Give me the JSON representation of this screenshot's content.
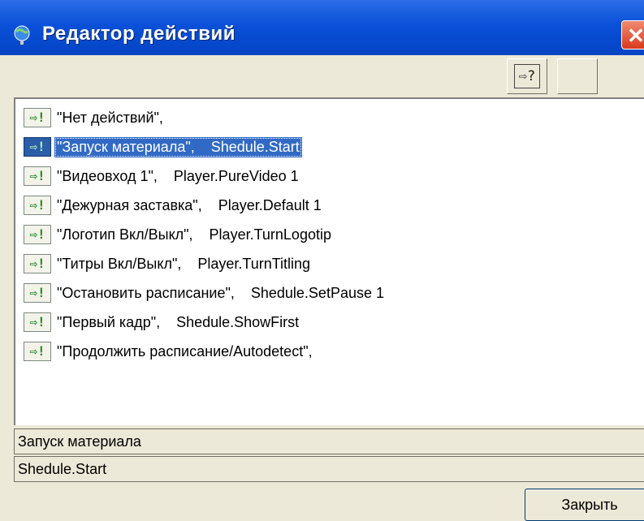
{
  "window": {
    "title": "Редактор действий",
    "close_glyph": "✕"
  },
  "toolbar": {
    "help_button_glyph": "⇨?",
    "second_button_label": ""
  },
  "actions": {
    "icon_glyph": "⇨!",
    "selected_index": 1,
    "items": [
      {
        "text": "\"Нет действий\","
      },
      {
        "text": "\"Запуск материала\",    Shedule.Start"
      },
      {
        "text": "\"Видеовход 1\",    Player.PureVideo 1"
      },
      {
        "text": "\"Дежурная заставка\",    Player.Default 1"
      },
      {
        "text": "\"Логотип Вкл/Выкл\",    Player.TurnLogotip"
      },
      {
        "text": "\"Титры Вкл/Выкл\",    Player.TurnTitling"
      },
      {
        "text": "\"Остановить расписание\",    Shedule.SetPause 1"
      },
      {
        "text": "\"Первый кадр\",    Shedule.ShowFirst"
      },
      {
        "text": "\"Продолжить расписание/Autodetect\","
      }
    ]
  },
  "details": {
    "name_value": "Запуск материала",
    "command_value": "Shedule.Start"
  },
  "footer": {
    "close_label": "Закрыть"
  },
  "colors": {
    "titlebar": "#0a50d8",
    "selection": "#316ac5",
    "dialog_bg": "#ece9d8"
  }
}
